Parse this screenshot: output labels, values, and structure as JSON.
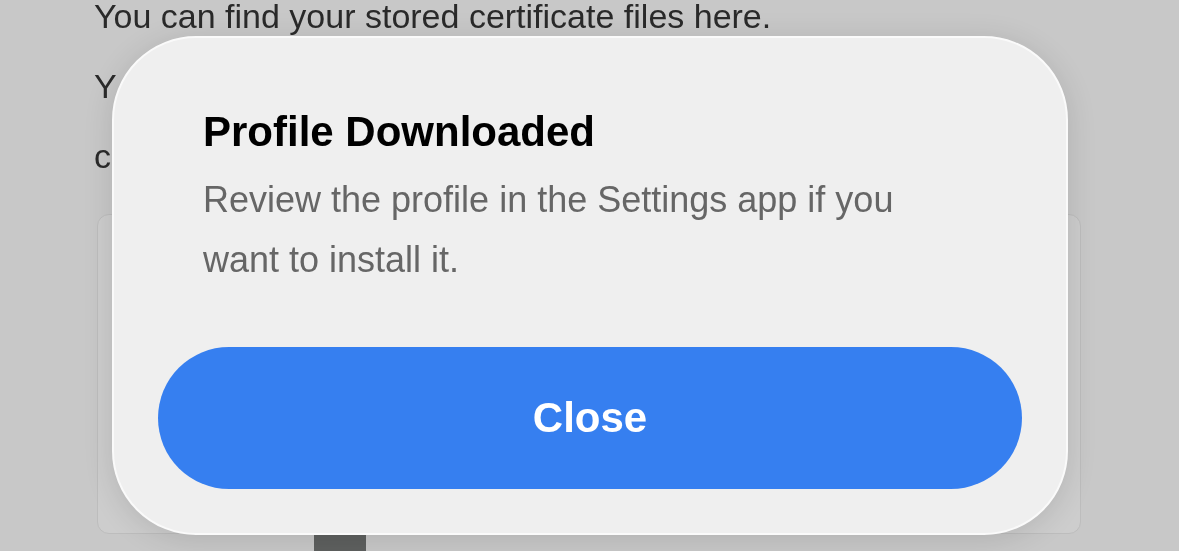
{
  "background": {
    "lines": [
      "You can find your stored certificate files here.",
      "Y",
      "c"
    ]
  },
  "dialog": {
    "title": "Profile Downloaded",
    "message": "Review the profile in the Settings app if you want to install it.",
    "button": "Close"
  }
}
